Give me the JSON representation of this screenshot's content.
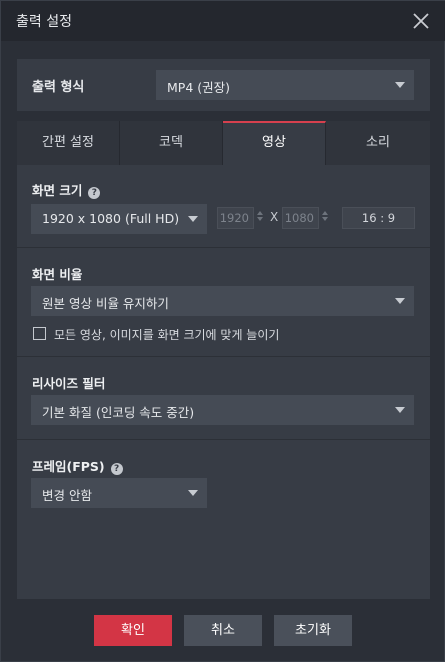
{
  "window": {
    "title": "출력 설정"
  },
  "output_format": {
    "label": "출력 형식",
    "value": "MP4 (권장)"
  },
  "tabs": [
    {
      "label": "간편 설정",
      "active": false
    },
    {
      "label": "코덱",
      "active": false
    },
    {
      "label": "영상",
      "active": true
    },
    {
      "label": "소리",
      "active": false
    }
  ],
  "screen_size": {
    "label": "화면 크기",
    "help_glyph": "?",
    "preset": "1920 x 1080 (Full HD)",
    "width": "1920",
    "height": "1080",
    "separator": "X",
    "aspect": "16 : 9"
  },
  "screen_ratio": {
    "label": "화면 비율",
    "value": "원본 영상 비율 유지하기",
    "checkbox_label": "모든 영상, 이미지를 화면 크기에 맞게 늘이기",
    "checked": false
  },
  "resize_filter": {
    "label": "리사이즈 필터",
    "value": "기본 화질 (인코딩 속도 중간)"
  },
  "frame_rate": {
    "label": "프레임(FPS)",
    "help_glyph": "?",
    "value": "변경 안함"
  },
  "buttons": {
    "ok": "확인",
    "cancel": "취소",
    "reset": "초기화"
  },
  "colors": {
    "accent": "#d33545",
    "panel": "#373c45",
    "background": "#2b2f37"
  }
}
